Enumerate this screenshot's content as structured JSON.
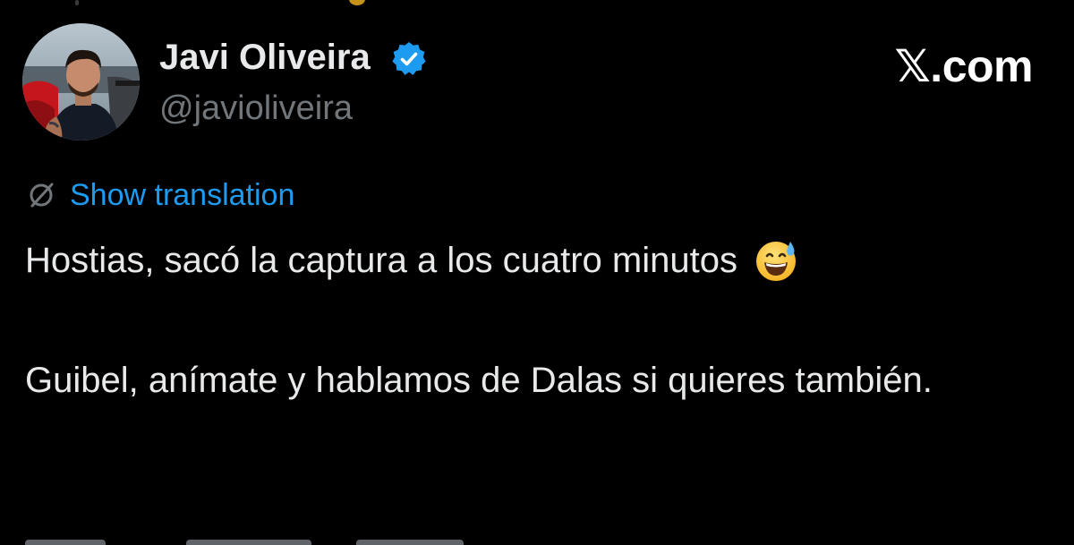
{
  "author": {
    "display_name": "Javi Oliveira",
    "handle": "@javioliveira",
    "verified": true,
    "avatar_icon": "profile-photo"
  },
  "brand": {
    "label": "𝕏.com"
  },
  "translation": {
    "icon": "globe-icon",
    "label": "Show translation"
  },
  "tweet": {
    "line1": "Hostias, sacó la captura a los cuatro minutos",
    "line1_emoji": "grinning-face-with-sweat",
    "paragraph2": "Guibel, anímate y hablamos de Dalas si quieres también."
  },
  "colors": {
    "background": "#000000",
    "text": "#e7e9ea",
    "secondary_text": "#71767b",
    "accent": "#1d9bf0",
    "verified_badge": "#1d9bf0"
  }
}
